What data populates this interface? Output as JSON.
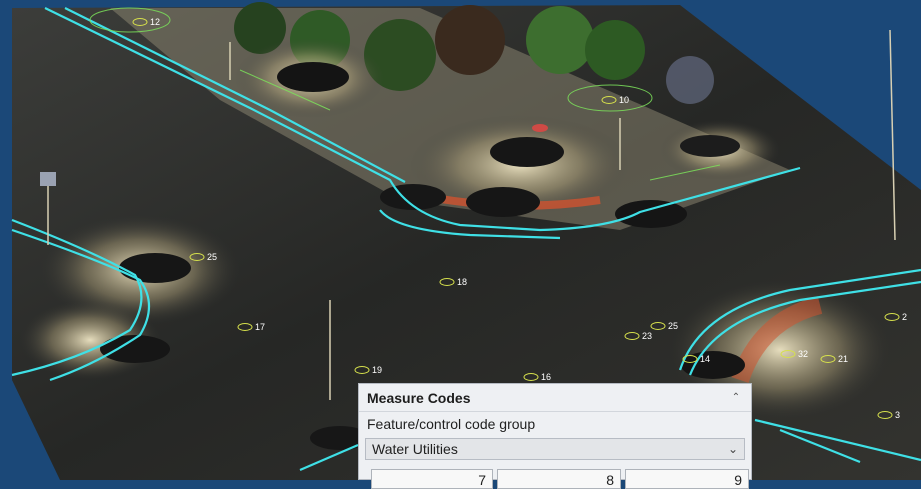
{
  "viewport": {
    "labels": [
      "12",
      "10",
      "25",
      "18",
      "17",
      "19",
      "16",
      "23",
      "25",
      "14",
      "32",
      "21",
      "2",
      "3"
    ]
  },
  "measure_codes": {
    "title": "Measure Codes",
    "group_label": "Feature/control code group",
    "selected_group": "Water Utilities",
    "code_buttons": [
      "7",
      "8",
      "9"
    ]
  },
  "colors": {
    "background": "#1b4878",
    "breakline": "#3fe0e6",
    "panel": "#eef0f3"
  }
}
